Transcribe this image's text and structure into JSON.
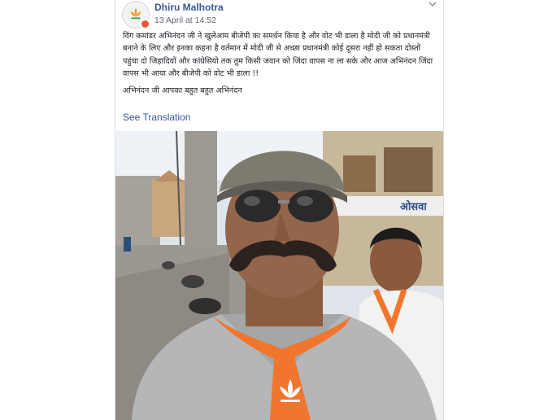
{
  "post": {
    "author": "Dhiru Malhotra",
    "timestamp": "13 April at 14:52",
    "paragraphs": [
      "विंग कमांडर अभिनंदन जी ने खुलेआम बीजेपी का समर्थन किया है और वोट भी डाला है मोदी जी को प्रधानमंत्री बनाने के लिए और इनका कहना है वर्तमान में मोदी जी से अच्छा प्रधानमंत्री कोई दूसरा नहीं हो सकता दोस्तों पहुंचा दो जिहादियों और कांग्रेसियो तक तुम किसी जवान को जिंदा वापस ना ला सके और आज अभिनंदन जिंदा वापस भी आया और बीजेपी को वोट भी डाला !!",
      "अभिनंदन जी आपका बहुत बहुत अभिनंदन"
    ],
    "translate_link": "See Translation",
    "photo_sign_text": "ओसवा"
  },
  "colors": {
    "link": "#385898",
    "text": "#1d2129",
    "meta": "#616770",
    "saffron": "#f0762e"
  },
  "icons": [
    "bjp-lotus-icon",
    "more-options-icon",
    "group-badge-icon"
  ]
}
